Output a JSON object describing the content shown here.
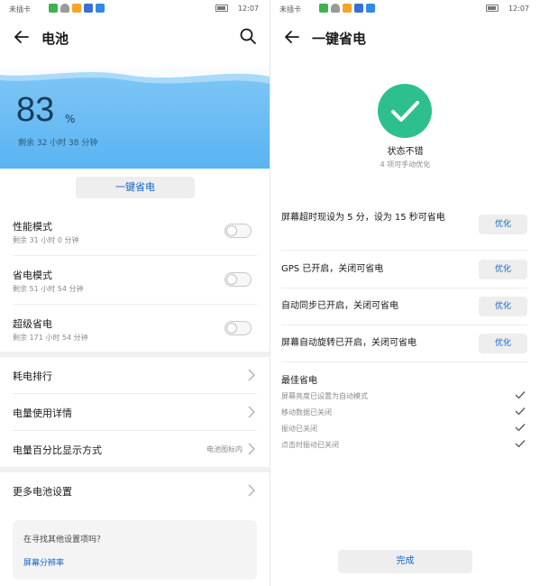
{
  "status_bar": {
    "carrier": "未插卡",
    "time": "12:07",
    "icon_names": [
      "wechat-icon",
      "wifi-icon",
      "app-icon",
      "app-icon",
      "app-icon"
    ]
  },
  "left": {
    "title": "电池",
    "battery_percent": "83",
    "percent_sign": "%",
    "remaining": "剩余 32 小时 38 分钟",
    "one_key_button": "一键省电",
    "modes": [
      {
        "title": "性能模式",
        "sub": "剩余 31 小时 0 分钟",
        "enabled": false
      },
      {
        "title": "省电模式",
        "sub": "剩余 51 小时 54 分钟",
        "enabled": false
      },
      {
        "title": "超级省电",
        "sub": "剩余 171 小时 54 分钟",
        "enabled": false
      }
    ],
    "nav": [
      {
        "label": "耗电排行",
        "value": ""
      },
      {
        "label": "电量使用详情",
        "value": ""
      },
      {
        "label": "电量百分比显示方式",
        "value": "电池图标内"
      }
    ],
    "more_settings": "更多电池设置",
    "search_card": {
      "question": "在寻找其他设置项吗？",
      "link": "屏幕分辨率"
    },
    "colors": {
      "hero_top": "#7fc6f6",
      "hero_bottom": "#5ab4f1",
      "accent": "#1463c9"
    }
  },
  "right": {
    "title": "一键省电",
    "status_title": "状态不错",
    "status_sub": "4 项可手动优化",
    "optimizations": [
      {
        "label": "屏幕超时现设为 5 分，设为 15 秒可省电",
        "button": "优化"
      },
      {
        "label": "GPS 已开启，关闭可省电",
        "button": "优化"
      },
      {
        "label": "自动同步已开启，关闭可省电",
        "button": "优化"
      },
      {
        "label": "屏幕自动旋转已开启，关闭可省电",
        "button": "优化"
      }
    ],
    "best_title": "最佳省电",
    "best_items": [
      "屏幕亮度已设置为自动模式",
      "移动数据已关闭",
      "振动已关闭",
      "点击时振动已关闭"
    ],
    "done_button": "完成",
    "colors": {
      "success": "#2ebf8f",
      "accent": "#1463c9"
    }
  }
}
